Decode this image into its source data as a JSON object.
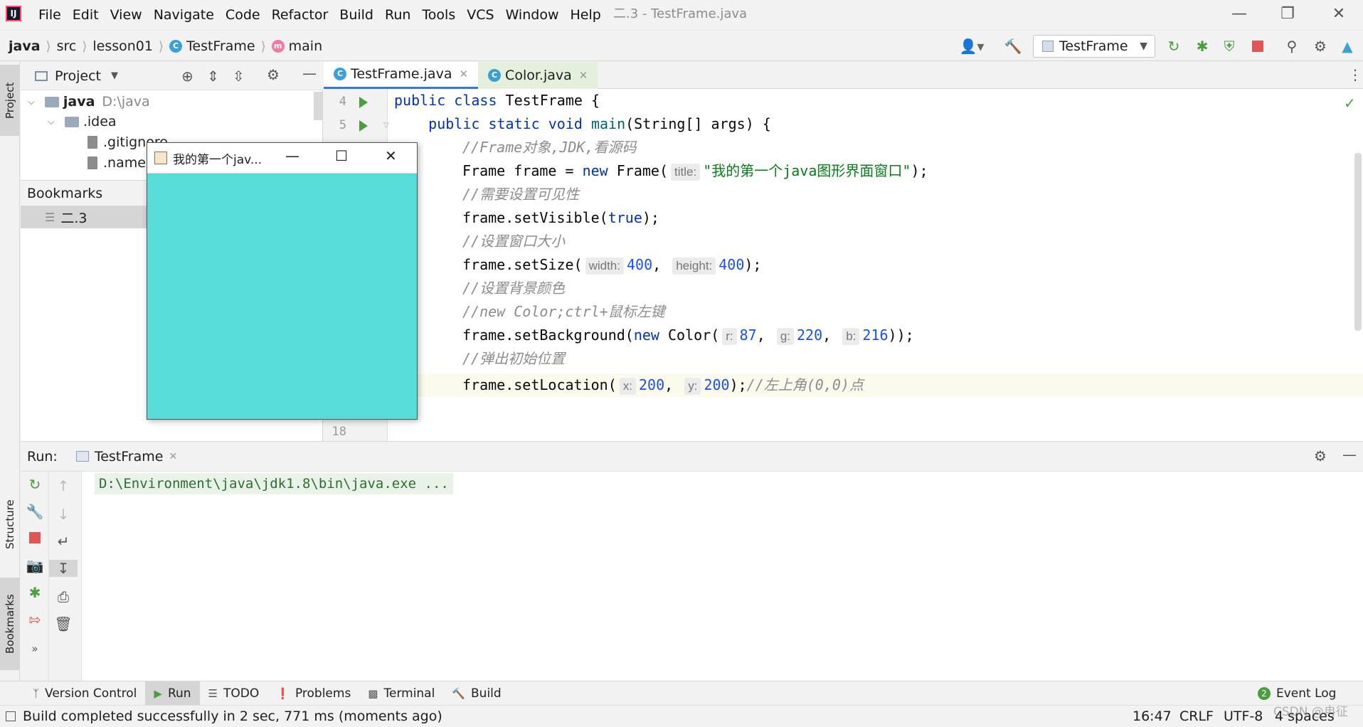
{
  "menubar": {
    "logo": "IJ",
    "items": [
      "File",
      "Edit",
      "View",
      "Navigate",
      "Code",
      "Refactor",
      "Build",
      "Run",
      "Tools",
      "VCS",
      "Window",
      "Help"
    ],
    "mnemonics": [
      "F",
      "E",
      "V",
      "N",
      "C",
      "R",
      "B",
      "R",
      "T",
      "S",
      "W",
      "H"
    ],
    "window_title": "二.3 - TestFrame.java"
  },
  "navbar": {
    "crumbs": [
      "java",
      "src",
      "lesson01",
      "TestFrame",
      "main"
    ],
    "run_config": "TestFrame"
  },
  "left_stripe": {
    "project": "Project",
    "structure": "Structure",
    "bookmarks": "Bookmarks"
  },
  "project": {
    "header": "Project",
    "root_name": "java",
    "root_path": "D:\\java",
    "idea": ".idea",
    "gitignore": ".gitignore",
    "name_file": ".name",
    "bookmarks_header": "Bookmarks",
    "bookmark_item": "二.3"
  },
  "editor": {
    "tabs": [
      "TestFrame.java",
      "Color.java"
    ],
    "line_numbers": [
      "4",
      "5",
      "18"
    ],
    "lines": {
      "l1a": "public class ",
      "l1b": "TestFrame {",
      "l2a": "    public static void ",
      "l2b": "main",
      "l2c": "(String[] args) {",
      "l3": "//Frame对象,JDK,看源码",
      "l4a": "Frame frame = ",
      "l4b": "new ",
      "l4c": "Frame(",
      "l4hint": "title:",
      "l4str": "\"我的第一个java图形界面窗口\"",
      "l4d": ");",
      "l5": "//需要设置可见性",
      "l6a": "frame.setVisible(",
      "l6b": "true",
      "l6c": ");",
      "l7": "//设置窗口大小",
      "l8a": "frame.setSize(",
      "l8h1": "width:",
      "l8n1": "400",
      "l8b": ", ",
      "l8h2": "height:",
      "l8n2": "400",
      "l8c": ");",
      "l9": "//设置背景颜色",
      "l10": "//new Color;ctrl+鼠标左键",
      "l11a": "frame.setBackground(",
      "l11b": "new ",
      "l11c": "Color(",
      "l11h1": "r:",
      "l11n1": "87",
      "l11d": ", ",
      "l11h2": "g:",
      "l11n2": "220",
      "l11e": ", ",
      "l11h3": "b:",
      "l11n3": "216",
      "l11f": "));",
      "l12": "//弹出初始位置",
      "l13a": "frame.setLocation(",
      "l13h1": "x:",
      "l13n1": "200",
      "l13b": ", ",
      "l13h2": "y:",
      "l13n2": "200",
      "l13c": ");",
      "l13cm": "//左上角(0,0)点"
    }
  },
  "java_window": {
    "title": "我的第一个jav...",
    "background": "#57dcd8"
  },
  "run": {
    "label": "Run:",
    "tab": "TestFrame",
    "output": "D:\\Environment\\java\\jdk1.8\\bin\\java.exe ..."
  },
  "bottom_tools": [
    "Version Control",
    "Run",
    "TODO",
    "Problems",
    "Terminal",
    "Build"
  ],
  "event_log": "Event Log",
  "status": {
    "message": "Build completed successfully in 2 sec, 771 ms (moments ago)",
    "position": "16:47",
    "line_sep": "CRLF",
    "encoding": "UTF-8",
    "indent": "4 spaces",
    "watermark": "CSDN @冉征"
  },
  "colors": {
    "accent": "#3574f0",
    "run_green": "#4a9e3d",
    "stop_red": "#e05555"
  }
}
